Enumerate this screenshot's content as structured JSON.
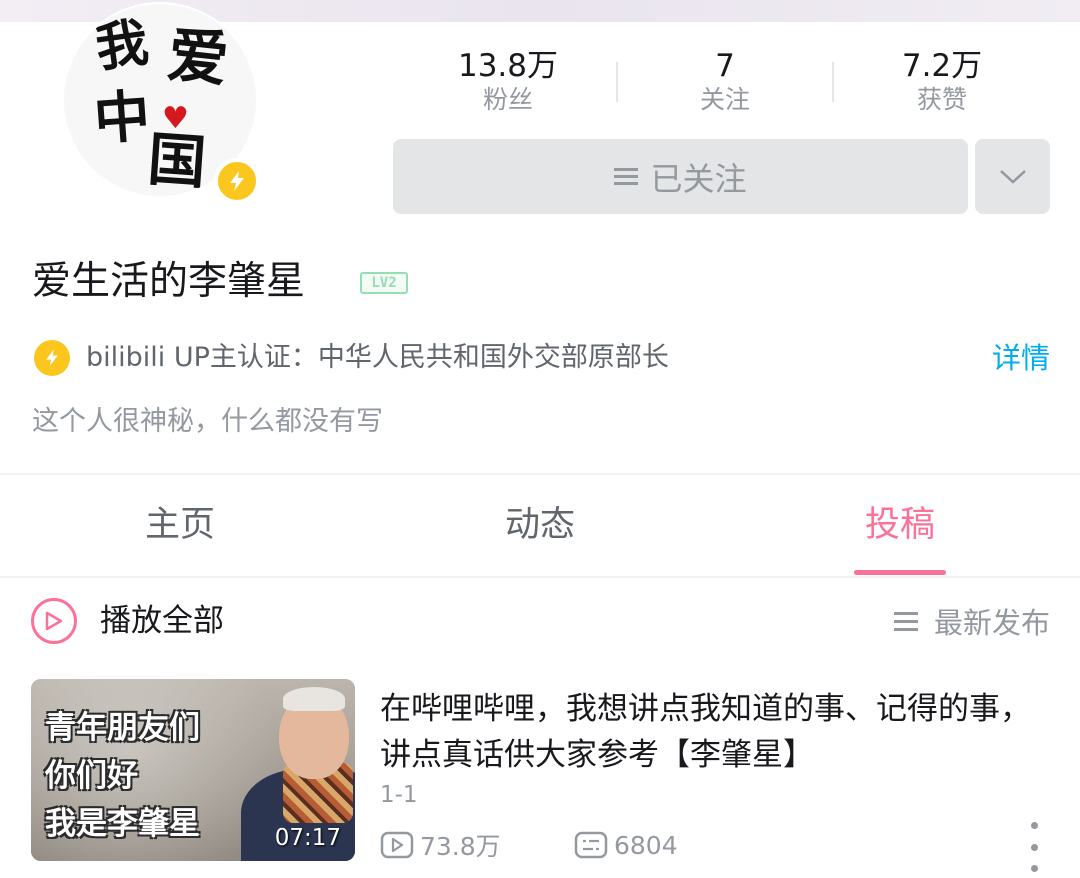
{
  "profile": {
    "avatar_text": [
      "我",
      "爱",
      "中",
      "国"
    ],
    "username": "爱生活的李肇星",
    "level": "LV2",
    "certification": "bilibili UP主认证：中华人民共和国外交部原部长",
    "detail_link": "详情",
    "bio": "这个人很神秘，什么都没有写"
  },
  "stats": [
    {
      "value": "13.8万",
      "label": "粉丝"
    },
    {
      "value": "7",
      "label": "关注"
    },
    {
      "value": "7.2万",
      "label": "获赞"
    }
  ],
  "actions": {
    "follow_label": "已关注"
  },
  "tabs": [
    {
      "label": "主页",
      "active": false
    },
    {
      "label": "动态",
      "active": false
    },
    {
      "label": "投稿",
      "active": true
    }
  ],
  "list_controls": {
    "play_all": "播放全部",
    "sort": "最新发布"
  },
  "videos": [
    {
      "thumbnail_lines": [
        "青年朋友们",
        "你们好",
        "我是李肇星"
      ],
      "duration": "07:17",
      "title": "在哔哩哔哩，我想讲点我知道的事、记得的事，讲点真话供大家参考【李肇星】",
      "subtitle": "1-1",
      "views": "73.8万",
      "danmaku": "6804"
    }
  ],
  "colors": {
    "accent_pink": "#fb7299",
    "link_blue": "#00aeec",
    "verify_yellow": "#fbc61d",
    "level_green": "#95ddb2"
  },
  "icons": {
    "verify": "lightning-icon",
    "dropdown": "chevron-down-icon",
    "menu": "menu-lines-icon",
    "play_all": "play-circle-icon",
    "views": "play-box-icon",
    "danmaku": "danmaku-icon",
    "more": "more-vertical-icon"
  }
}
